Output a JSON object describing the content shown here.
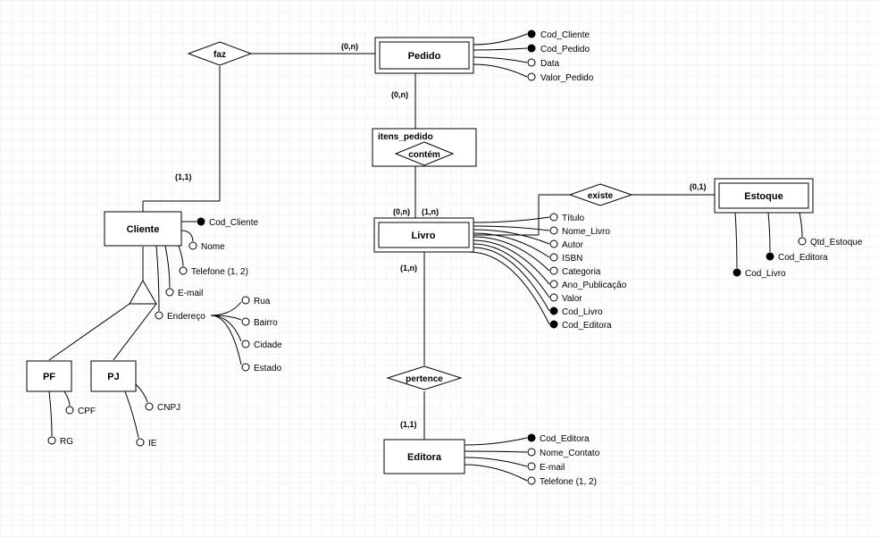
{
  "entities": {
    "pedido": "Pedido",
    "cliente": "Cliente",
    "livro": "Livro",
    "estoque": "Estoque",
    "editora": "Editora",
    "pf": "PF",
    "pj": "PJ"
  },
  "relations": {
    "faz": "faz",
    "itens_pedido": "itens_pedido",
    "contem": "contém",
    "existe": "existe",
    "pertence": "pertence"
  },
  "cardinalities": {
    "faz_pedido": "(0,n)",
    "faz_cliente": "(1,1)",
    "pedido_contem": "(0,n)",
    "contem_livro_left": "(0,n)",
    "contem_livro_right": "(1,n)",
    "livro_pertence": "(1,n)",
    "pertence_editora": "(1,1)",
    "existe_estoque": "(0,1)"
  },
  "attributes": {
    "pedido": {
      "cod_cliente": "Cod_Cliente",
      "cod_pedido": "Cod_Pedido",
      "data": "Data",
      "valor_pedido": "Valor_Pedido"
    },
    "cliente": {
      "cod_cliente": "Cod_Cliente",
      "nome": "Nome",
      "telefone": "Telefone (1, 2)",
      "email": "E-mail",
      "endereco": "Endereço",
      "rua": "Rua",
      "bairro": "Bairro",
      "cidade": "Cidade",
      "estado": "Estado"
    },
    "pf": {
      "cpf": "CPF",
      "rg": "RG"
    },
    "pj": {
      "cnpj": "CNPJ",
      "ie": "IE"
    },
    "livro": {
      "titulo": "Título",
      "nome_livro": "Nome_Livro",
      "autor": "Autor",
      "isbn": "ISBN",
      "categoria": "Categoria",
      "ano_publicacao": "Ano_Publicação",
      "valor": "Valor",
      "cod_livro": "Cod_Livro",
      "cod_editora": "Cod_Editora"
    },
    "estoque": {
      "qtd_estoque": "Qtd_Estoque",
      "cod_editora": "Cod_Editora",
      "cod_livro": "Cod_Livro"
    },
    "editora": {
      "cod_editora": "Cod_Editora",
      "nome_contato": "Nome_Contato",
      "email": "E-mail",
      "telefone": "Telefone (1, 2)"
    }
  }
}
